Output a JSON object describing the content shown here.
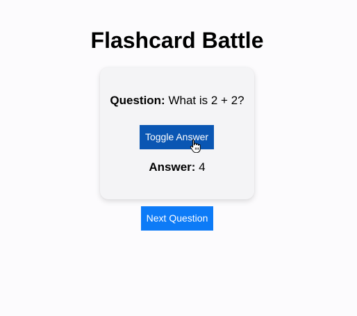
{
  "page": {
    "title": "Flashcard Battle"
  },
  "card": {
    "question_label": "Question:",
    "question_text": "What is 2 + 2?",
    "toggle_label": "Toggle Answer",
    "answer_label": "Answer:",
    "answer_text": "4"
  },
  "controls": {
    "next_label": "Next Question"
  },
  "colors": {
    "toggle_button": "#0a56b3",
    "next_button": "#0d7bf7",
    "card_background": "#f4f4f6"
  },
  "icons": {
    "cursor": "hand-pointer-cursor-icon"
  }
}
